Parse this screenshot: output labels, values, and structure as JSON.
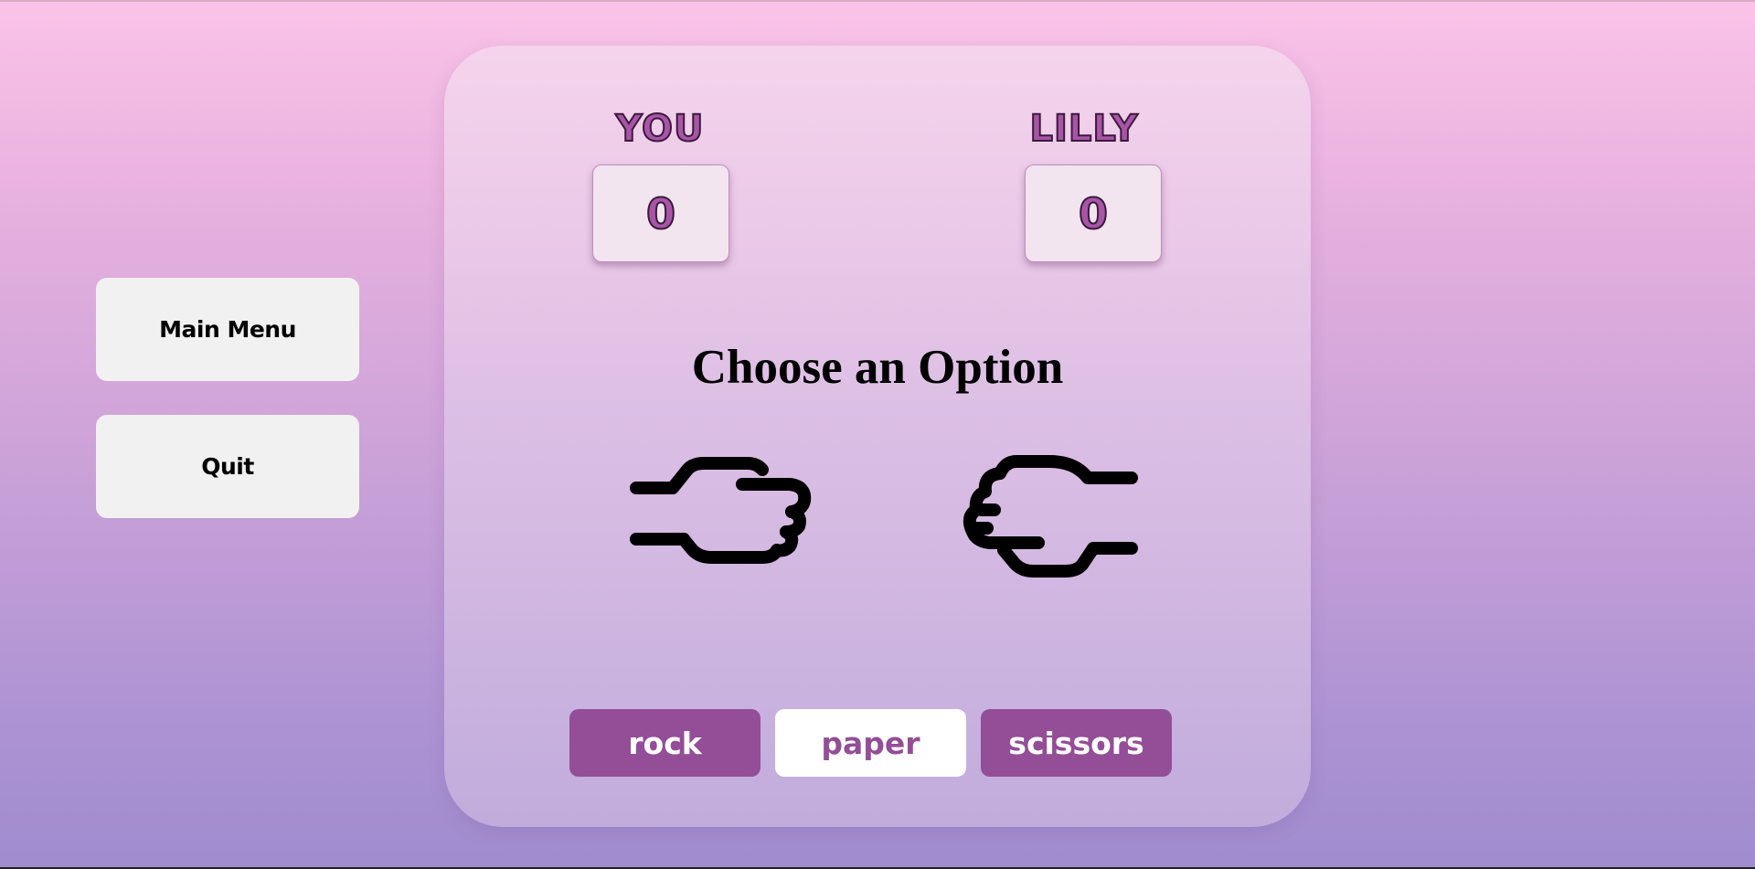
{
  "side_menu": {
    "main_menu_label": "Main Menu",
    "quit_label": "Quit"
  },
  "scoreboard": {
    "player_name": "YOU",
    "player_score": "0",
    "opponent_name": "LILLY",
    "opponent_score": "0"
  },
  "game": {
    "heading": "Choose an Option",
    "player_hand": "rock-hand-icon",
    "opponent_hand": "paper-hand-icon"
  },
  "choices": {
    "rock_label": "rock",
    "paper_label": "paper",
    "scissors_label": "scissors",
    "selected": "paper"
  },
  "colors": {
    "accent": "#934e97",
    "score_text": "#a855a8"
  }
}
